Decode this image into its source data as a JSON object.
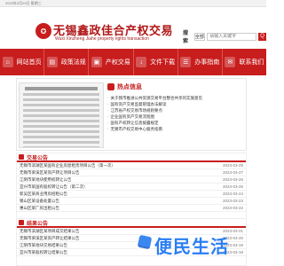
{
  "topbar": {
    "date_text": "2023年3月29日 星期三"
  },
  "header": {
    "brand_cn": "无锡鑫政佳合产权交易",
    "brand_en": "Wuxi Xinzheng Jiahe property rights transaction",
    "search": {
      "label": "搜索",
      "scope": "全部",
      "placeholder": "请输入关键字",
      "button_label": "Q"
    }
  },
  "nav": {
    "items": [
      {
        "label": "网站首页",
        "icon": "home-icon",
        "glyph": "⌂"
      },
      {
        "label": "政策法规",
        "icon": "book-icon",
        "glyph": "▤"
      },
      {
        "label": "产权交易",
        "icon": "trade-icon",
        "glyph": "▣"
      },
      {
        "label": "文件下载",
        "icon": "download-icon",
        "glyph": "↓"
      },
      {
        "label": "办事指南",
        "icon": "guide-icon",
        "glyph": "☰"
      },
      {
        "label": "联系我们",
        "icon": "contact-icon",
        "glyph": "✉"
      }
    ]
  },
  "hot": {
    "title": "热点信息",
    "items": [
      "关于我市推进公共资源交易平台整合共享的实施意见",
      "国有资产交易监督管理办法解读",
      "江苏省产权交易市场规则要点",
      "企业国有资产交易流程图",
      "国有产权转让信息披露规定",
      "无锡市产权交易中心服务指南"
    ]
  },
  "sections": {
    "notice": {
      "title": "交易公告",
      "rows": [
        {
          "text": "无锡市滨湖区某国有企业房屋租赁项目公告（第一次）",
          "date": "2023-03-28"
        },
        {
          "text": "无锡市梁溪区某资产转让项目公告",
          "date": "2023-03-27"
        },
        {
          "text": "江阴市某地块使用权转让公告",
          "date": "2023-03-26"
        },
        {
          "text": "宜兴市某国有股权转让公告（第二次）",
          "date": "2023-03-25"
        },
        {
          "text": "新吴区某商业用房招租公告",
          "date": "2023-03-24"
        },
        {
          "text": "锡山区某设备处置公告",
          "date": "2023-03-23"
        },
        {
          "text": "惠山区某厂房出租公告",
          "date": "2023-03-22"
        }
      ]
    },
    "result": {
      "title": "结果公告",
      "rows": [
        {
          "text": "无锡市滨湖区某项目成交结果公告",
          "date": "2023-03-21"
        },
        {
          "text": "无锡市梁溪区某资产转让结果公告",
          "date": "2023-03-20"
        },
        {
          "text": "江阴市某地块交易结果公告",
          "date": "2023-03-19"
        },
        {
          "text": "宜兴市某股权转让结果公告",
          "date": "2023-03-18"
        }
      ]
    }
  },
  "watermark": {
    "text": "便民生活",
    "icon": "watermark-icon"
  }
}
